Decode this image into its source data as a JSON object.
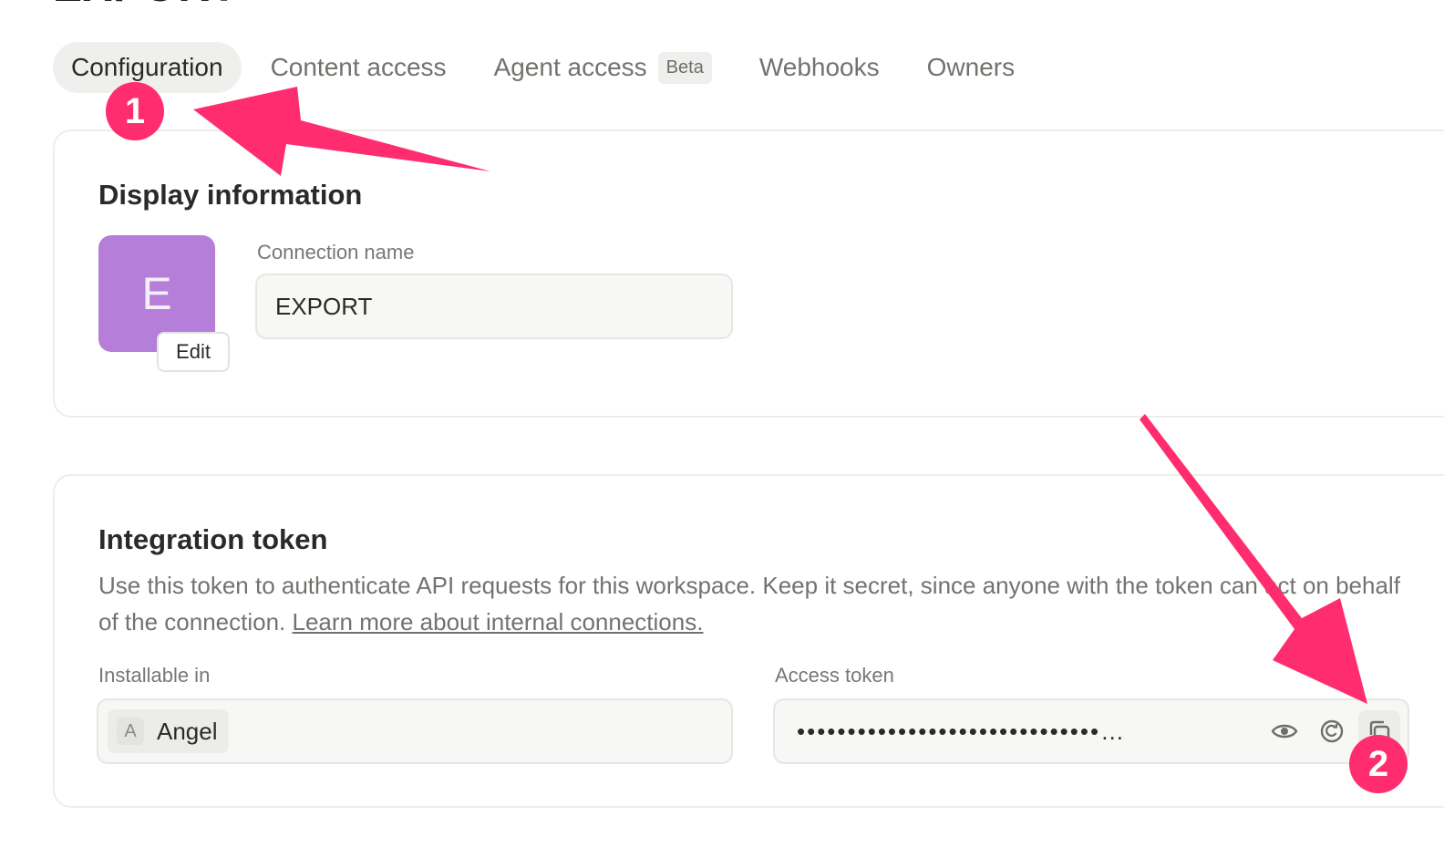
{
  "page": {
    "title_cut": "EXPORT"
  },
  "tabs": [
    {
      "label": "Configuration",
      "active": true
    },
    {
      "label": "Content access"
    },
    {
      "label": "Agent access",
      "badge": "Beta"
    },
    {
      "label": "Webhooks"
    },
    {
      "label": "Owners"
    }
  ],
  "display_information": {
    "heading": "Display information",
    "avatar_letter": "E",
    "edit_label": "Edit",
    "connection_name_label": "Connection name",
    "connection_name_value": "EXPORT"
  },
  "integration_token": {
    "heading": "Integration token",
    "description": "Use this token to authenticate API requests for this workspace. Keep it secret, since anyone with the token can act on behalf of the connection.",
    "learn_more": "Learn more about internal connections.",
    "installable_label": "Installable in",
    "workspace_letter": "A",
    "workspace_name": "Angel",
    "access_token_label": "Access token",
    "access_token_masked": "••••••••••••••••••••••••••••••…",
    "icons": [
      "eye-icon",
      "refresh-icon",
      "copy-icon"
    ]
  },
  "annotations": {
    "badge_1": "1",
    "badge_2": "2",
    "color": "#ff2d6f"
  }
}
